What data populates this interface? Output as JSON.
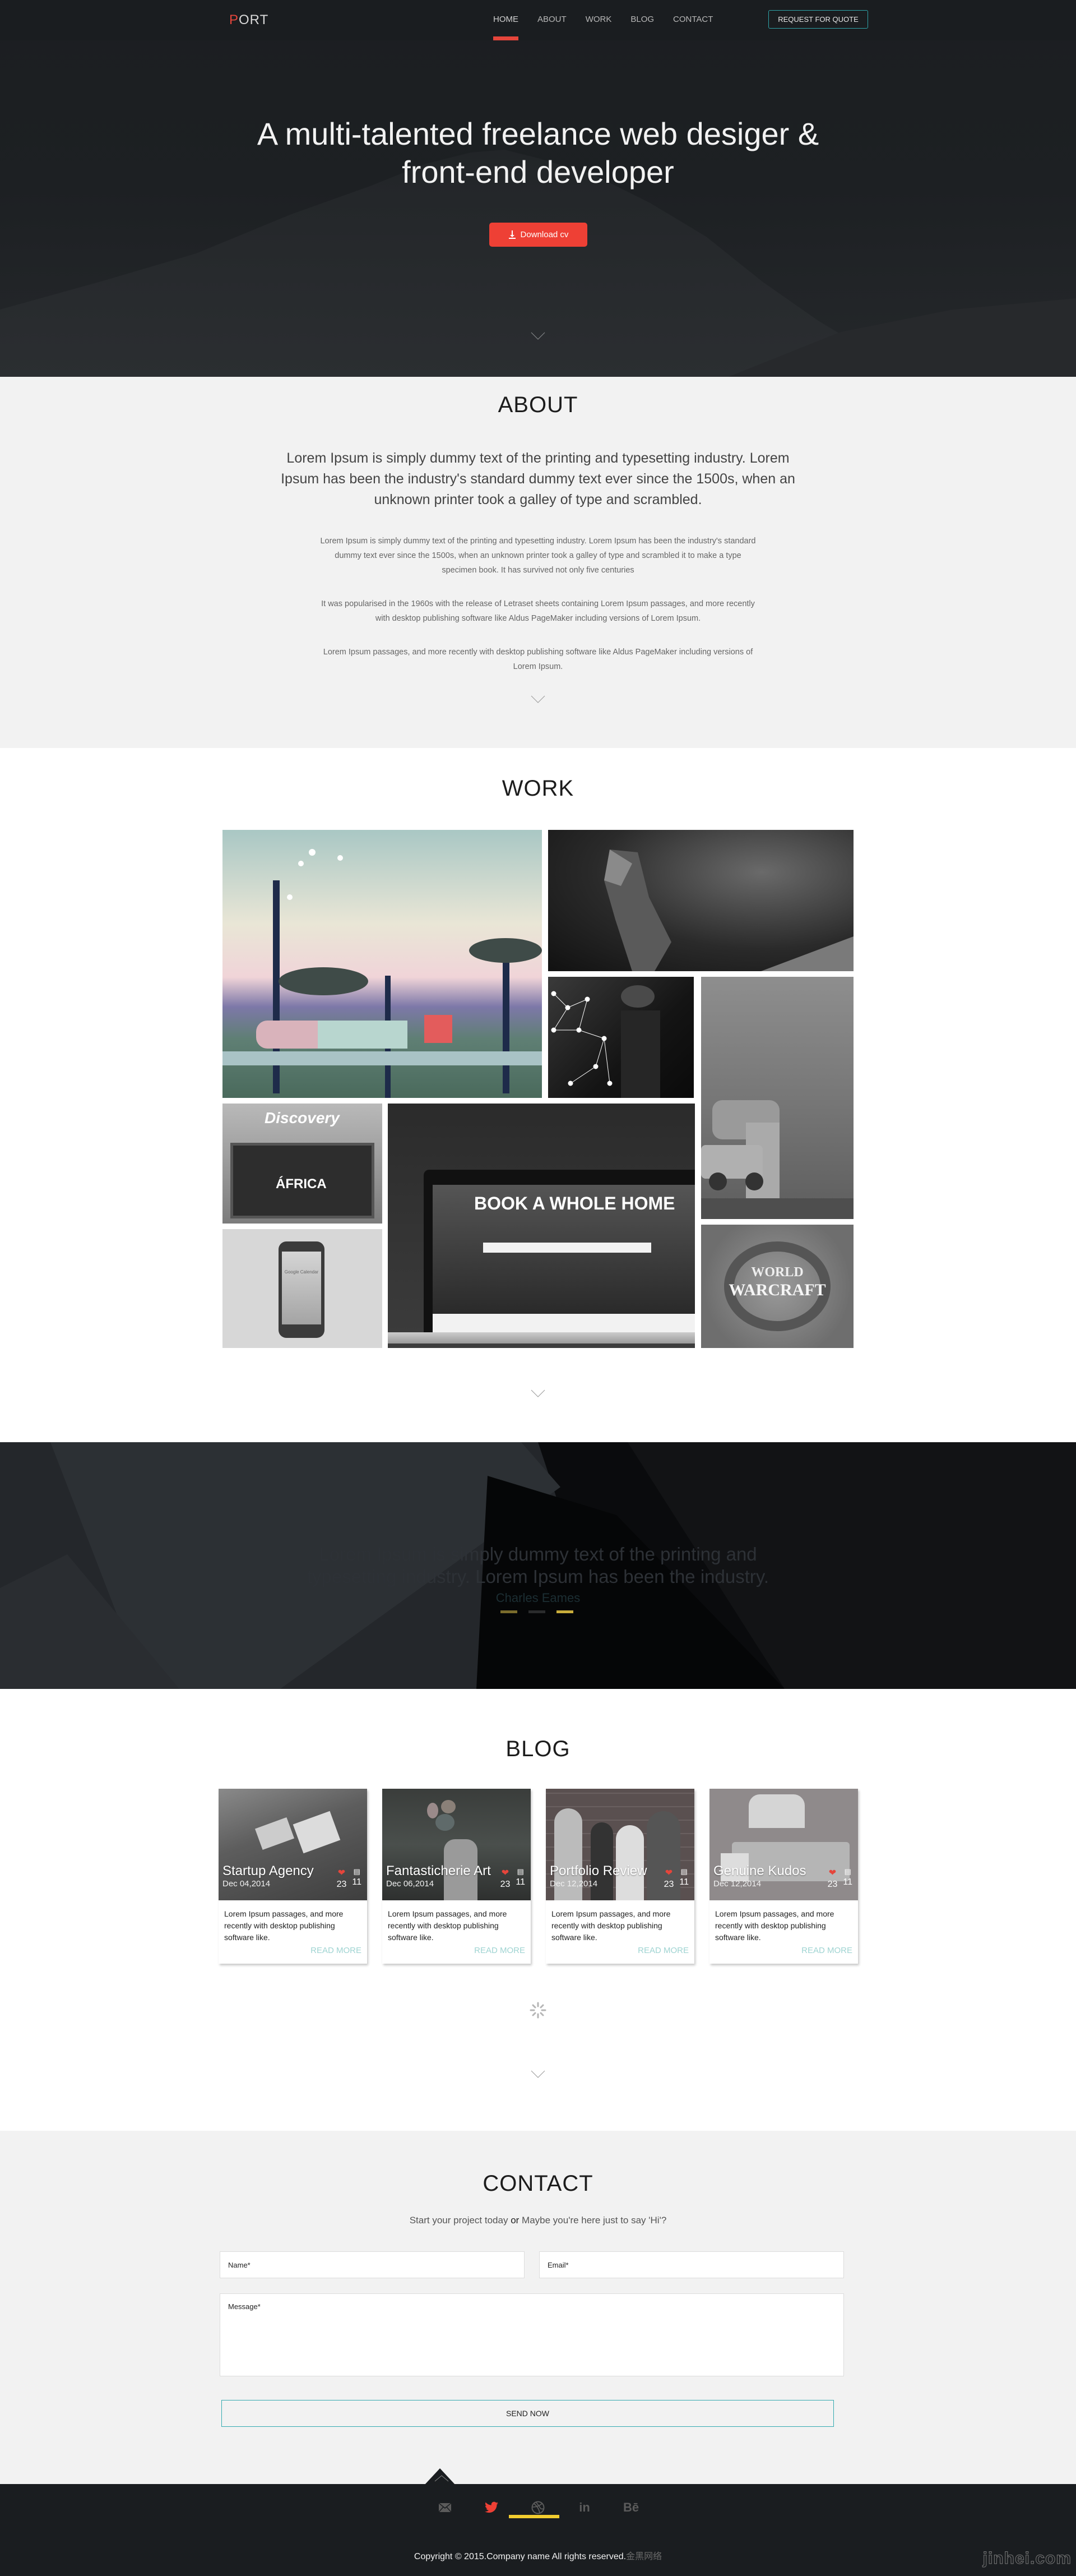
{
  "nav": {
    "logo_first": "P",
    "logo_rest": "ORT",
    "links": [
      {
        "label": "HOME",
        "active": true
      },
      {
        "label": "ABOUT",
        "active": false
      },
      {
        "label": "WORK",
        "active": false
      },
      {
        "label": "BLOG",
        "active": false
      },
      {
        "label": "CONTACT",
        "active": false
      }
    ],
    "cta_label": "REQUEST FOR QUOTE"
  },
  "hero": {
    "title_line1": "A multi-talented freelance web desiger &",
    "title_line2": "front-end developer",
    "cv_button": "Download cv",
    "scroll_icon": "chevron-down-icon"
  },
  "about": {
    "title": "ABOUT",
    "lead": "Lorem Ipsum is simply dummy text of the printing and typesetting industry. Lorem Ipsum has been the industry's standard dummy text ever since the 1500s, when an unknown printer took a galley of type and scrambled.",
    "paragraphs": [
      "Lorem Ipsum is simply dummy text of the printing and typesetting industry. Lorem Ipsum has been the industry's standard dummy text ever since the 1500s, when an unknown printer took a galley of type and scrambled it to make a type specimen book. It has survived not only five centuries",
      "It was popularised in the 1960s with the release of Letraset sheets containing Lorem Ipsum passages, and more recently with desktop publishing software like Aldus PageMaker including versions of Lorem Ipsum.",
      "Lorem Ipsum passages, and more recently with desktop publishing software like Aldus PageMaker including versions of Lorem Ipsum."
    ]
  },
  "work": {
    "title": "WORK",
    "items": [
      {
        "name": "illustrated-landscape"
      },
      {
        "name": "polygon-eagle"
      },
      {
        "name": "constellation-portrait"
      },
      {
        "name": "car-stairs-photo"
      },
      {
        "name": "discovery-africa",
        "text1": "Discovery",
        "text2": "ÁFRICA"
      },
      {
        "name": "book-a-whole-home",
        "text1": "BOOK A WHOLE HOME"
      },
      {
        "name": "google-calendar-phone",
        "text1": "Google Calendar"
      },
      {
        "name": "world-of-warcraft",
        "text1": "WORLD",
        "text2": "WARCRAFT"
      }
    ]
  },
  "testimonial": {
    "quote": "Lorem Ipsum is simply dummy text of the printing and typesetting industry. Lorem Ipsum has been the industry.",
    "author": "Charles Eames",
    "slides": 3,
    "active_slide": 3,
    "colors": {
      "dot_active": "#c9ad3b",
      "dot_dim": "#7a6c2c",
      "dot_off": "#2a2b2c"
    }
  },
  "blog": {
    "title": "BLOG",
    "posts": [
      {
        "title": "Startup Agency",
        "date": "Dec 04,2014",
        "likes": "23",
        "comments": "11",
        "excerpt": "Lorem Ipsum passages, and more recently with desktop publishing software like.",
        "link": "READ MORE"
      },
      {
        "title": "Fantasticherie Art",
        "date": "Dec 06,2014",
        "likes": "23",
        "comments": "11",
        "excerpt": "Lorem Ipsum passages, and more recently with desktop publishing software like.",
        "link": "READ MORE"
      },
      {
        "title": "Portfolio Review",
        "date": "Dec 12,2014",
        "likes": "23",
        "comments": "11",
        "excerpt": "Lorem Ipsum passages, and more recently with desktop publishing software like.",
        "link": "READ MORE"
      },
      {
        "title": "Genuine Kudos",
        "date": "Dec 12,2014",
        "likes": "23",
        "comments": "11",
        "excerpt": "Lorem Ipsum passages, and more recently with desktop publishing software like.",
        "link": "READ MORE"
      }
    ],
    "loader_icon": "spinner-icon"
  },
  "contact": {
    "title": "CONTACT",
    "sub_part1": "Start your project today ",
    "sub_or": "or",
    "sub_part2": " Maybe you're here just to say 'Hi'?",
    "name_placeholder": "Name*",
    "email_placeholder": "Email*",
    "message_placeholder": "Message*",
    "send_label": "SEND NOW"
  },
  "footer": {
    "social": [
      "mail-icon",
      "twitter-icon",
      "dribbble-icon",
      "linkedin-icon",
      "behance-icon"
    ],
    "active_social": "dribbble-icon",
    "copyright": "Copyright © 2015.Company name All rights reserved.",
    "copyright_cn": "金黑网络",
    "watermark": "jinhei.com"
  },
  "colors": {
    "accent_red": "#ee4035",
    "accent_teal": "#2fa3a8",
    "link_teal": "#9fd4d2",
    "accent_yellow": "#f2cd2f",
    "dark_bg": "#1a1d20",
    "light_bg": "#f2f2f2"
  }
}
